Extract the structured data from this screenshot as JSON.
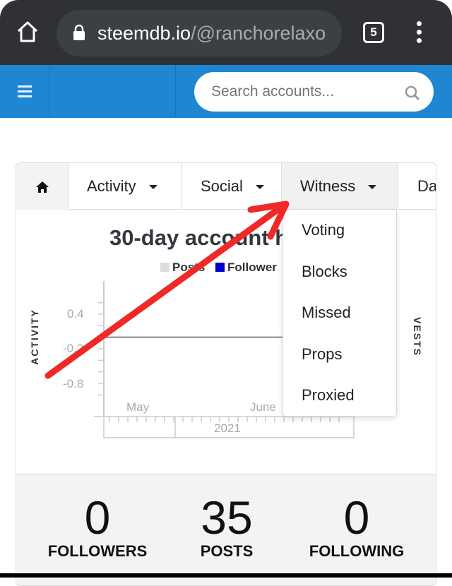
{
  "browser": {
    "url_domain": "steemdb.io",
    "url_path": "/@ranchorelaxo",
    "tab_count": "5"
  },
  "header": {
    "search_placeholder": "Search accounts..."
  },
  "nav": {
    "items": [
      "Activity",
      "Social",
      "Witness",
      "Data"
    ]
  },
  "dropdown": {
    "items": [
      "Voting",
      "Blocks",
      "Missed",
      "Props",
      "Proxied"
    ]
  },
  "chart_data": {
    "type": "line",
    "title": "30-day account h",
    "legend": [
      {
        "name": "Posts",
        "color": "#dddddd"
      },
      {
        "name": "Follower",
        "color": "#0000cc"
      }
    ],
    "ylabel": "ACTIVITY",
    "y2label": "VESTS",
    "yticks": [
      "0.4",
      "-0.2",
      "-0.8"
    ],
    "xticks": [
      "May",
      "June"
    ],
    "xgroup": "2021",
    "series": [
      {
        "values": [
          0,
          0
        ]
      }
    ]
  },
  "stats": [
    {
      "value": "0",
      "label": "FOLLOWERS"
    },
    {
      "value": "35",
      "label": "POSTS"
    },
    {
      "value": "0",
      "label": "FOLLOWING"
    }
  ]
}
